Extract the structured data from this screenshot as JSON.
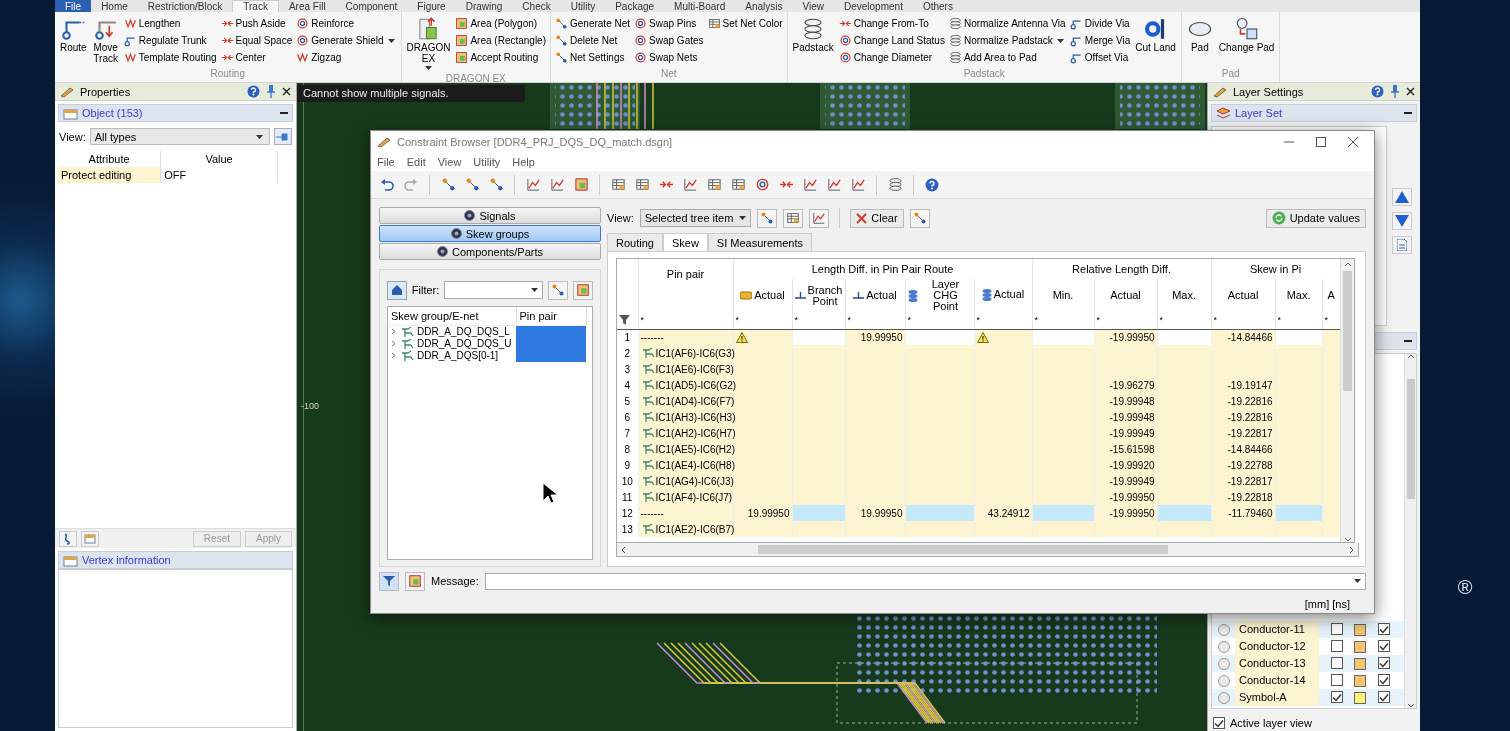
{
  "ribbon": {
    "tabs": [
      {
        "label": "File",
        "kind": "file",
        "selected": false
      },
      {
        "label": "Home",
        "kind": "tab",
        "selected": false
      },
      {
        "label": "Restriction/Block",
        "kind": "tab",
        "selected": false
      },
      {
        "label": "Track",
        "kind": "tab",
        "selected": true
      },
      {
        "label": "Area Fill",
        "kind": "tab",
        "selected": false
      },
      {
        "label": "Component",
        "kind": "tab",
        "selected": false
      },
      {
        "label": "Figure",
        "kind": "tab",
        "selected": false
      },
      {
        "label": "Drawing",
        "kind": "tab",
        "selected": false
      },
      {
        "label": "Check",
        "kind": "tab",
        "selected": false
      },
      {
        "label": "Utility",
        "kind": "tab",
        "selected": false
      },
      {
        "label": "Package",
        "kind": "tab",
        "selected": false
      },
      {
        "label": "Multi-Board",
        "kind": "tab",
        "selected": false
      },
      {
        "label": "Analysis",
        "kind": "tab",
        "selected": false
      },
      {
        "label": "View",
        "kind": "tab",
        "selected": false
      },
      {
        "label": "Development",
        "kind": "tab",
        "selected": false
      },
      {
        "label": "Others",
        "kind": "tab",
        "selected": false
      }
    ],
    "groups": [
      {
        "title": "Routing",
        "columns": [
          [
            {
              "label": "Route",
              "kind": "large",
              "dropdown": false
            }
          ],
          [
            {
              "label": "Move\nTrack",
              "kind": "large",
              "dropdown": false
            }
          ],
          [
            {
              "label": "Lengthen",
              "kind": "small",
              "dropdown": false
            },
            {
              "label": "Regulate Trunk",
              "kind": "small",
              "dropdown": false
            },
            {
              "label": "Template Routing",
              "kind": "small",
              "dropdown": false
            }
          ],
          [
            {
              "label": "Push Aside",
              "kind": "small",
              "dropdown": false
            },
            {
              "label": "Equal Space",
              "kind": "small",
              "dropdown": false
            },
            {
              "label": "Center",
              "kind": "small",
              "dropdown": false
            }
          ],
          [
            {
              "label": "Reinforce",
              "kind": "small",
              "dropdown": false
            },
            {
              "label": "Generate Shield",
              "kind": "small",
              "dropdown": true
            },
            {
              "label": "Zigzag",
              "kind": "small",
              "dropdown": false
            }
          ]
        ]
      },
      {
        "title": "DRAGON EX",
        "columns": [
          [
            {
              "label": "DRAGON\nEX",
              "kind": "large",
              "dropdown": true
            }
          ],
          [
            {
              "label": "Area (Polygon)",
              "kind": "small",
              "dropdown": false
            },
            {
              "label": "Area (Rectangle)",
              "kind": "small",
              "dropdown": false
            },
            {
              "label": "Accept Routing",
              "kind": "small",
              "dropdown": false
            }
          ]
        ]
      },
      {
        "title": "Net",
        "columns": [
          [
            {
              "label": "Generate Net",
              "kind": "small",
              "dropdown": false
            },
            {
              "label": "Delete Net",
              "kind": "small",
              "dropdown": false
            },
            {
              "label": "Net Settings",
              "kind": "small",
              "dropdown": false
            }
          ],
          [
            {
              "label": "Swap Pins",
              "kind": "small",
              "dropdown": false
            },
            {
              "label": "Swap Gates",
              "kind": "small",
              "dropdown": false
            },
            {
              "label": "Swap Nets",
              "kind": "small",
              "dropdown": false
            }
          ],
          [
            {
              "label": "Set Net Color",
              "kind": "small",
              "dropdown": false
            }
          ]
        ]
      },
      {
        "title": "Padstack",
        "columns": [
          [
            {
              "label": "Padstack",
              "kind": "large",
              "dropdown": false
            }
          ],
          [
            {
              "label": "Change From-To",
              "kind": "small",
              "dropdown": false
            },
            {
              "label": "Change Land Status",
              "kind": "small",
              "dropdown": false
            },
            {
              "label": "Change Diameter",
              "kind": "small",
              "dropdown": false
            }
          ],
          [
            {
              "label": "Normalize Antenna Via",
              "kind": "small",
              "dropdown": false
            },
            {
              "label": "Normalize Padstack",
              "kind": "small",
              "dropdown": true
            },
            {
              "label": "Add Area to Pad",
              "kind": "small",
              "dropdown": false
            }
          ],
          [
            {
              "label": "Divide Via",
              "kind": "small",
              "dropdown": false
            },
            {
              "label": "Merge Via",
              "kind": "small",
              "dropdown": false
            },
            {
              "label": "Offset Via",
              "kind": "small",
              "dropdown": false
            }
          ],
          [
            {
              "label": "Cut Land",
              "kind": "large",
              "dropdown": false
            }
          ]
        ]
      },
      {
        "title": "Pad",
        "columns": [
          [
            {
              "label": "Pad",
              "kind": "large",
              "dropdown": false
            }
          ],
          [
            {
              "label": "Change Pad",
              "kind": "large",
              "dropdown": false
            }
          ]
        ]
      }
    ]
  },
  "properties_panel": {
    "title": "Properties",
    "section": "Object (153)",
    "view_label": "View:",
    "view_value": "All types",
    "columns": [
      "Attribute",
      "Value"
    ],
    "rows": [
      {
        "attribute": "Protect editing",
        "value": "OFF"
      }
    ],
    "buttons": [
      {
        "label": "Reset",
        "disabled": true
      },
      {
        "label": "Apply",
        "disabled": true
      }
    ]
  },
  "vertex_panel": {
    "title": "Vertex information"
  },
  "canvas": {
    "message": "Cannot show multiple signals.",
    "ruler_label": "-100"
  },
  "layer_panel": {
    "title": "Layer Settings",
    "section": "Layer Set",
    "layers": [
      {
        "name": "Conductor-11",
        "selected": false,
        "checkbox_1": false,
        "color": "#f5c46e",
        "checkbox_2": true
      },
      {
        "name": "Conductor-12",
        "selected": false,
        "checkbox_1": false,
        "color": "#f5c46e",
        "checkbox_2": true
      },
      {
        "name": "Conductor-13",
        "selected": false,
        "checkbox_1": false,
        "color": "#f5c46e",
        "checkbox_2": true
      },
      {
        "name": "Conductor-14",
        "selected": false,
        "checkbox_1": false,
        "color": "#f5c46e",
        "checkbox_2": true
      },
      {
        "name": "Symbol-A",
        "selected": false,
        "checkbox_1": true,
        "color": "#fff27a",
        "checkbox_2": true
      }
    ],
    "active_layer_view": {
      "label": "Active layer view",
      "checked": true
    }
  },
  "constraint_browser": {
    "title": "Constraint Browser [DDR4_PRJ_DQS_DQ_match.dsgn]",
    "menu": [
      "File",
      "Edit",
      "View",
      "Utility",
      "Help"
    ],
    "modes": [
      {
        "label": "Signals",
        "selected": false
      },
      {
        "label": "Skew groups",
        "selected": true
      },
      {
        "label": "Components/Parts",
        "selected": false
      }
    ],
    "filter_label": "Filter:",
    "tree": {
      "columns": [
        "Skew group/E-net",
        "Pin pair"
      ],
      "rows": [
        {
          "name": "DDR_A_DQ_DQS_L",
          "expanded": false,
          "selected": true
        },
        {
          "name": "DDR_A_DQ_DQS_U",
          "expanded": false,
          "selected": true
        },
        {
          "name": "DDR_A_DQS[0-1]",
          "expanded": false,
          "selected": true
        }
      ]
    },
    "view_label": "View:",
    "view_value": "Selected tree item",
    "clear_button": "Clear",
    "update_button": "Update values",
    "tabs": [
      {
        "label": "Routing",
        "selected": false
      },
      {
        "label": "Skew",
        "selected": true
      },
      {
        "label": "SI Measurements",
        "selected": false
      }
    ],
    "grid": {
      "pin_pair_header": "Pin pair",
      "pin_pair_filter": "*",
      "groups": [
        {
          "label": "Length Diff. in Pin Pair Route",
          "columns": [
            {
              "label": "Actual",
              "kind": "tag",
              "constraint": false,
              "filter": "*"
            },
            {
              "label": "Branch Point",
              "kind": "branch",
              "constraint": true,
              "filter": "*"
            },
            {
              "label": "Actual",
              "kind": "branch",
              "constraint": false,
              "filter": "*"
            },
            {
              "label": "Layer CHG Point",
              "kind": "layers",
              "constraint": true,
              "filter": "*"
            },
            {
              "label": "Actual",
              "kind": "layers",
              "constraint": false,
              "filter": "*"
            }
          ]
        },
        {
          "label": "Relative Length Diff.",
          "columns": [
            {
              "label": "Min.",
              "kind": "plain",
              "constraint": true,
              "filter": "*"
            },
            {
              "label": "Actual",
              "kind": "plain",
              "constraint": false,
              "filter": "*"
            },
            {
              "label": "Max.",
              "kind": "plain",
              "constraint": true,
              "filter": "*"
            }
          ]
        },
        {
          "label": "Skew in Pi",
          "columns": [
            {
              "label": "Actual",
              "kind": "plain",
              "constraint": false,
              "filter": "*"
            },
            {
              "label": "Max.",
              "kind": "plain",
              "constraint": true,
              "filter": "*"
            },
            {
              "label": "A",
              "kind": "plain",
              "constraint": false,
              "filter": "*"
            }
          ]
        }
      ],
      "rows": [
        {
          "number": "1",
          "kind": "group",
          "highlighted": false,
          "pin_pair": "-------",
          "cells": [
            {
              "kind": "warning"
            },
            {
              "kind": "blank"
            },
            {
              "kind": "value",
              "text": "19.99950"
            },
            {
              "kind": "blank"
            },
            {
              "kind": "warning"
            },
            {
              "kind": "blank"
            },
            {
              "kind": "value",
              "text": "-19.99950"
            },
            {
              "kind": "blank"
            },
            {
              "kind": "value",
              "text": "-14.84466"
            },
            {
              "kind": "blank"
            },
            {
              "kind": "blank"
            }
          ]
        },
        {
          "number": "2",
          "kind": "pair",
          "pin_pair": "IC1(AF6)-IC6(G3)",
          "cells": [
            {
              "kind": "blank"
            },
            {
              "kind": "blank"
            },
            {
              "kind": "blank"
            },
            {
              "kind": "blank"
            },
            {
              "kind": "blank"
            },
            {
              "kind": "blank"
            },
            {
              "kind": "blank"
            },
            {
              "kind": "blank"
            },
            {
              "kind": "blank"
            },
            {
              "kind": "blank"
            },
            {
              "kind": "blank"
            }
          ]
        },
        {
          "number": "3",
          "kind": "pair",
          "pin_pair": "IC1(AE6)-IC6(F3)",
          "cells": [
            {
              "kind": "blank"
            },
            {
              "kind": "blank"
            },
            {
              "kind": "blank"
            },
            {
              "kind": "blank"
            },
            {
              "kind": "blank"
            },
            {
              "kind": "blank"
            },
            {
              "kind": "blank"
            },
            {
              "kind": "blank"
            },
            {
              "kind": "blank"
            },
            {
              "kind": "blank"
            },
            {
              "kind": "blank"
            }
          ]
        },
        {
          "number": "4",
          "kind": "pair",
          "pin_pair": "IC1(AD5)-IC6(G2)",
          "cells": [
            {
              "kind": "blank"
            },
            {
              "kind": "blank"
            },
            {
              "kind": "blank"
            },
            {
              "kind": "blank"
            },
            {
              "kind": "blank"
            },
            {
              "kind": "blank"
            },
            {
              "kind": "value",
              "text": "-19.96279"
            },
            {
              "kind": "blank"
            },
            {
              "kind": "value",
              "text": "-19.19147"
            },
            {
              "kind": "blank"
            },
            {
              "kind": "blank"
            }
          ]
        },
        {
          "number": "5",
          "kind": "pair",
          "pin_pair": "IC1(AD4)-IC6(F7)",
          "cells": [
            {
              "kind": "blank"
            },
            {
              "kind": "blank"
            },
            {
              "kind": "blank"
            },
            {
              "kind": "blank"
            },
            {
              "kind": "blank"
            },
            {
              "kind": "blank"
            },
            {
              "kind": "value",
              "text": "-19.99948"
            },
            {
              "kind": "blank"
            },
            {
              "kind": "value",
              "text": "-19.22816"
            },
            {
              "kind": "blank"
            },
            {
              "kind": "blank"
            }
          ]
        },
        {
          "number": "6",
          "kind": "pair",
          "pin_pair": "IC1(AH3)-IC6(H3)",
          "cells": [
            {
              "kind": "blank"
            },
            {
              "kind": "blank"
            },
            {
              "kind": "blank"
            },
            {
              "kind": "blank"
            },
            {
              "kind": "blank"
            },
            {
              "kind": "blank"
            },
            {
              "kind": "value",
              "text": "-19.99948"
            },
            {
              "kind": "blank"
            },
            {
              "kind": "value",
              "text": "-19.22816"
            },
            {
              "kind": "blank"
            },
            {
              "kind": "blank"
            }
          ]
        },
        {
          "number": "7",
          "kind": "pair",
          "pin_pair": "IC1(AH2)-IC6(H7)",
          "cells": [
            {
              "kind": "blank"
            },
            {
              "kind": "blank"
            },
            {
              "kind": "blank"
            },
            {
              "kind": "blank"
            },
            {
              "kind": "blank"
            },
            {
              "kind": "blank"
            },
            {
              "kind": "value",
              "text": "-19.99949"
            },
            {
              "kind": "blank"
            },
            {
              "kind": "value",
              "text": "-19.22817"
            },
            {
              "kind": "blank"
            },
            {
              "kind": "blank"
            }
          ]
        },
        {
          "number": "8",
          "kind": "pair",
          "pin_pair": "IC1(AE5)-IC6(H2)",
          "cells": [
            {
              "kind": "blank"
            },
            {
              "kind": "blank"
            },
            {
              "kind": "blank"
            },
            {
              "kind": "blank"
            },
            {
              "kind": "blank"
            },
            {
              "kind": "blank"
            },
            {
              "kind": "value",
              "text": "-15.61598"
            },
            {
              "kind": "blank"
            },
            {
              "kind": "value",
              "text": "-14.84466"
            },
            {
              "kind": "blank"
            },
            {
              "kind": "blank"
            }
          ]
        },
        {
          "number": "9",
          "kind": "pair",
          "pin_pair": "IC1(AE4)-IC6(H8)",
          "cells": [
            {
              "kind": "blank"
            },
            {
              "kind": "blank"
            },
            {
              "kind": "blank"
            },
            {
              "kind": "blank"
            },
            {
              "kind": "blank"
            },
            {
              "kind": "blank"
            },
            {
              "kind": "value",
              "text": "-19.99920"
            },
            {
              "kind": "blank"
            },
            {
              "kind": "value",
              "text": "-19.22788"
            },
            {
              "kind": "blank"
            },
            {
              "kind": "blank"
            }
          ]
        },
        {
          "number": "10",
          "kind": "pair",
          "pin_pair": "IC1(AG4)-IC6(J3)",
          "cells": [
            {
              "kind": "blank"
            },
            {
              "kind": "blank"
            },
            {
              "kind": "blank"
            },
            {
              "kind": "blank"
            },
            {
              "kind": "blank"
            },
            {
              "kind": "blank"
            },
            {
              "kind": "value",
              "text": "-19.99949"
            },
            {
              "kind": "blank"
            },
            {
              "kind": "value",
              "text": "-19.22817"
            },
            {
              "kind": "blank"
            },
            {
              "kind": "blank"
            }
          ]
        },
        {
          "number": "11",
          "kind": "pair",
          "pin_pair": "IC1(AF4)-IC6(J7)",
          "cells": [
            {
              "kind": "blank"
            },
            {
              "kind": "blank"
            },
            {
              "kind": "blank"
            },
            {
              "kind": "blank"
            },
            {
              "kind": "blank"
            },
            {
              "kind": "blank"
            },
            {
              "kind": "value",
              "text": "-19.99950"
            },
            {
              "kind": "blank"
            },
            {
              "kind": "value",
              "text": "-19.22818"
            },
            {
              "kind": "blank"
            },
            {
              "kind": "blank"
            }
          ]
        },
        {
          "number": "12",
          "kind": "group",
          "highlighted": true,
          "pin_pair": "-------",
          "cells": [
            {
              "kind": "value",
              "text": "19.99950"
            },
            {
              "kind": "blank"
            },
            {
              "kind": "value",
              "text": "19.99950"
            },
            {
              "kind": "blank"
            },
            {
              "kind": "value",
              "text": "43.24912"
            },
            {
              "kind": "blank"
            },
            {
              "kind": "value",
              "text": "-19.99950"
            },
            {
              "kind": "blank"
            },
            {
              "kind": "value",
              "text": "-11.79460"
            },
            {
              "kind": "blank"
            },
            {
              "kind": "blank"
            }
          ]
        },
        {
          "number": "13",
          "kind": "pair",
          "pin_pair": "IC1(AE2)-IC6(B7)",
          "cells": [
            {
              "kind": "blank"
            },
            {
              "kind": "blank"
            },
            {
              "kind": "blank"
            },
            {
              "kind": "blank"
            },
            {
              "kind": "blank"
            },
            {
              "kind": "blank"
            },
            {
              "kind": "blank"
            },
            {
              "kind": "blank"
            },
            {
              "kind": "blank"
            },
            {
              "kind": "blank"
            },
            {
              "kind": "blank"
            }
          ]
        }
      ]
    },
    "message_label": "Message:",
    "units": "[mm] [ns]"
  },
  "background": {
    "mark": "®"
  }
}
